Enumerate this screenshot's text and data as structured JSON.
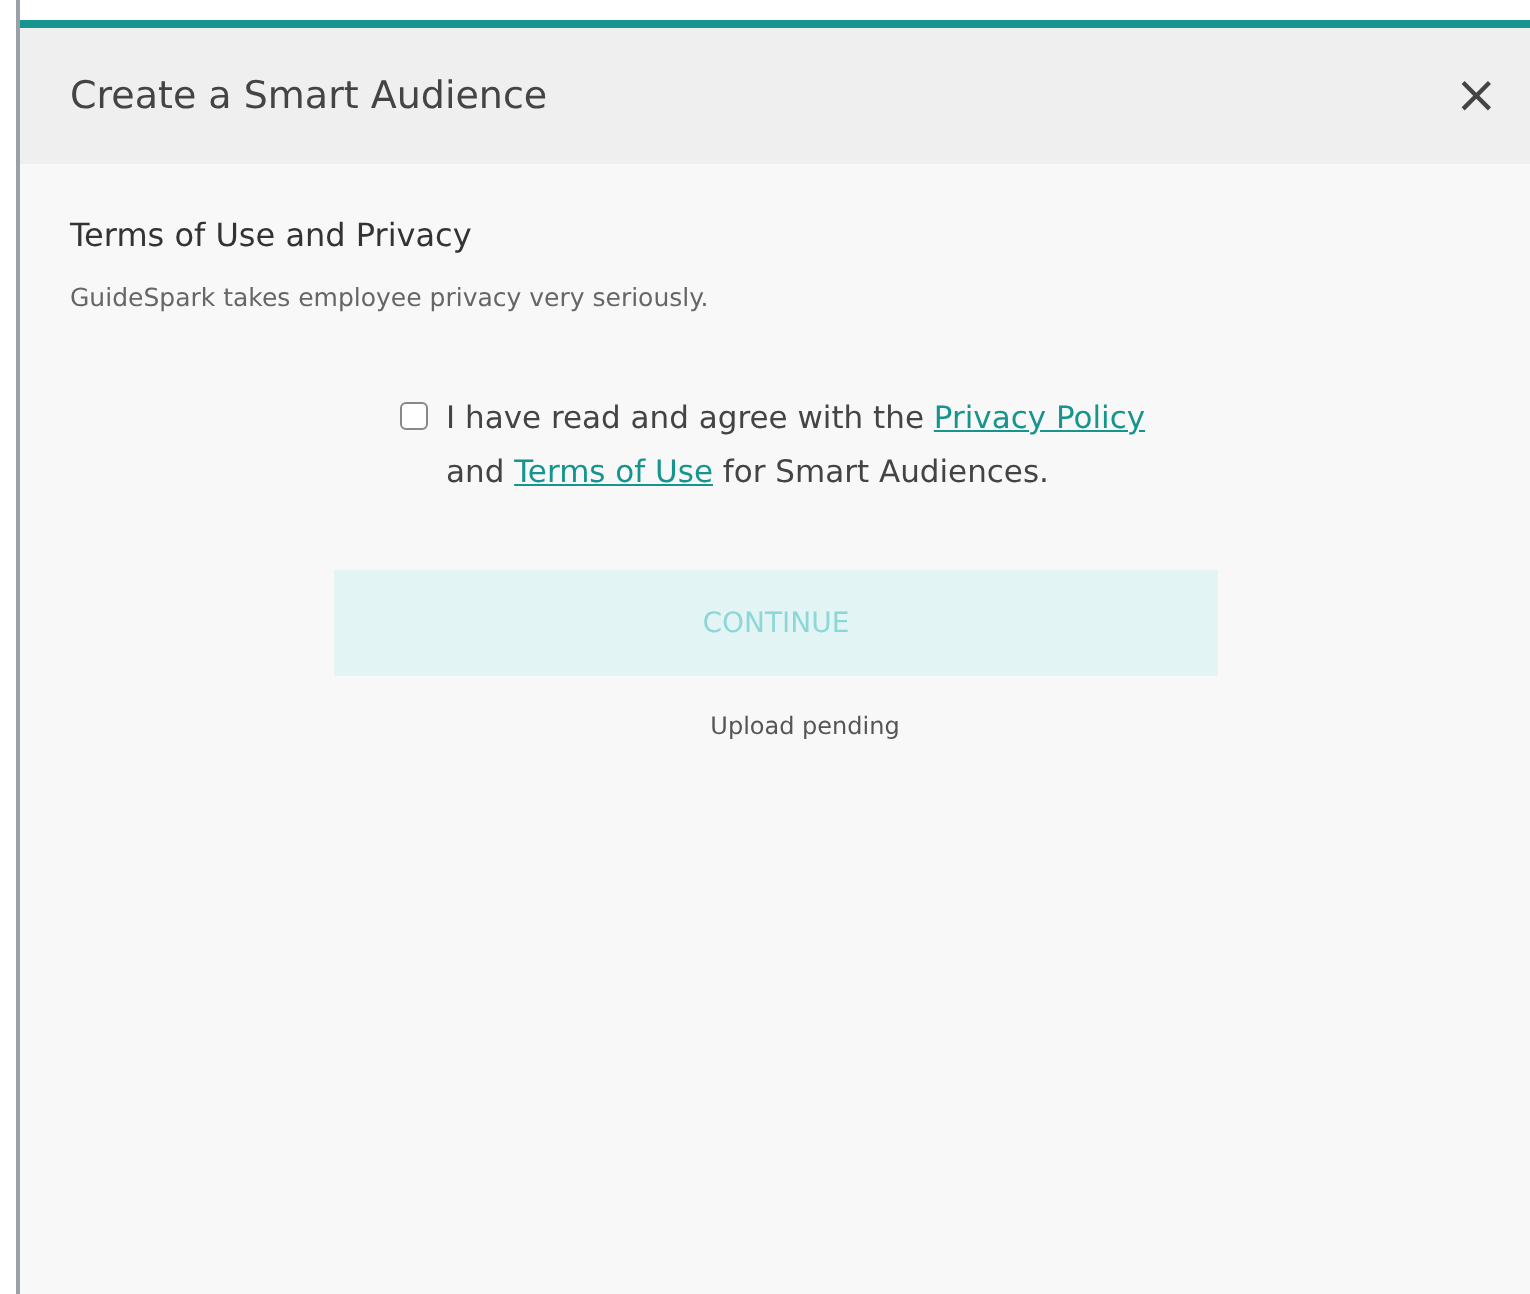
{
  "dialog": {
    "title": "Create a Smart Audience",
    "close": "×"
  },
  "section": {
    "heading": "Terms of Use and Privacy",
    "description": "GuideSpark takes employee privacy very seriously."
  },
  "agreement": {
    "checked": false,
    "parts": [
      {
        "kind": "text",
        "text": "I have read and agree with the "
      },
      {
        "kind": "link",
        "text": "Privacy Policy"
      },
      {
        "kind": "text",
        "text": " and "
      },
      {
        "kind": "link",
        "text": "Terms of Use"
      },
      {
        "kind": "text",
        "text": " for Smart Audiences."
      }
    ]
  },
  "continue_button": {
    "label": "CONTINUE",
    "disabled": true
  },
  "status": "Upload pending"
}
